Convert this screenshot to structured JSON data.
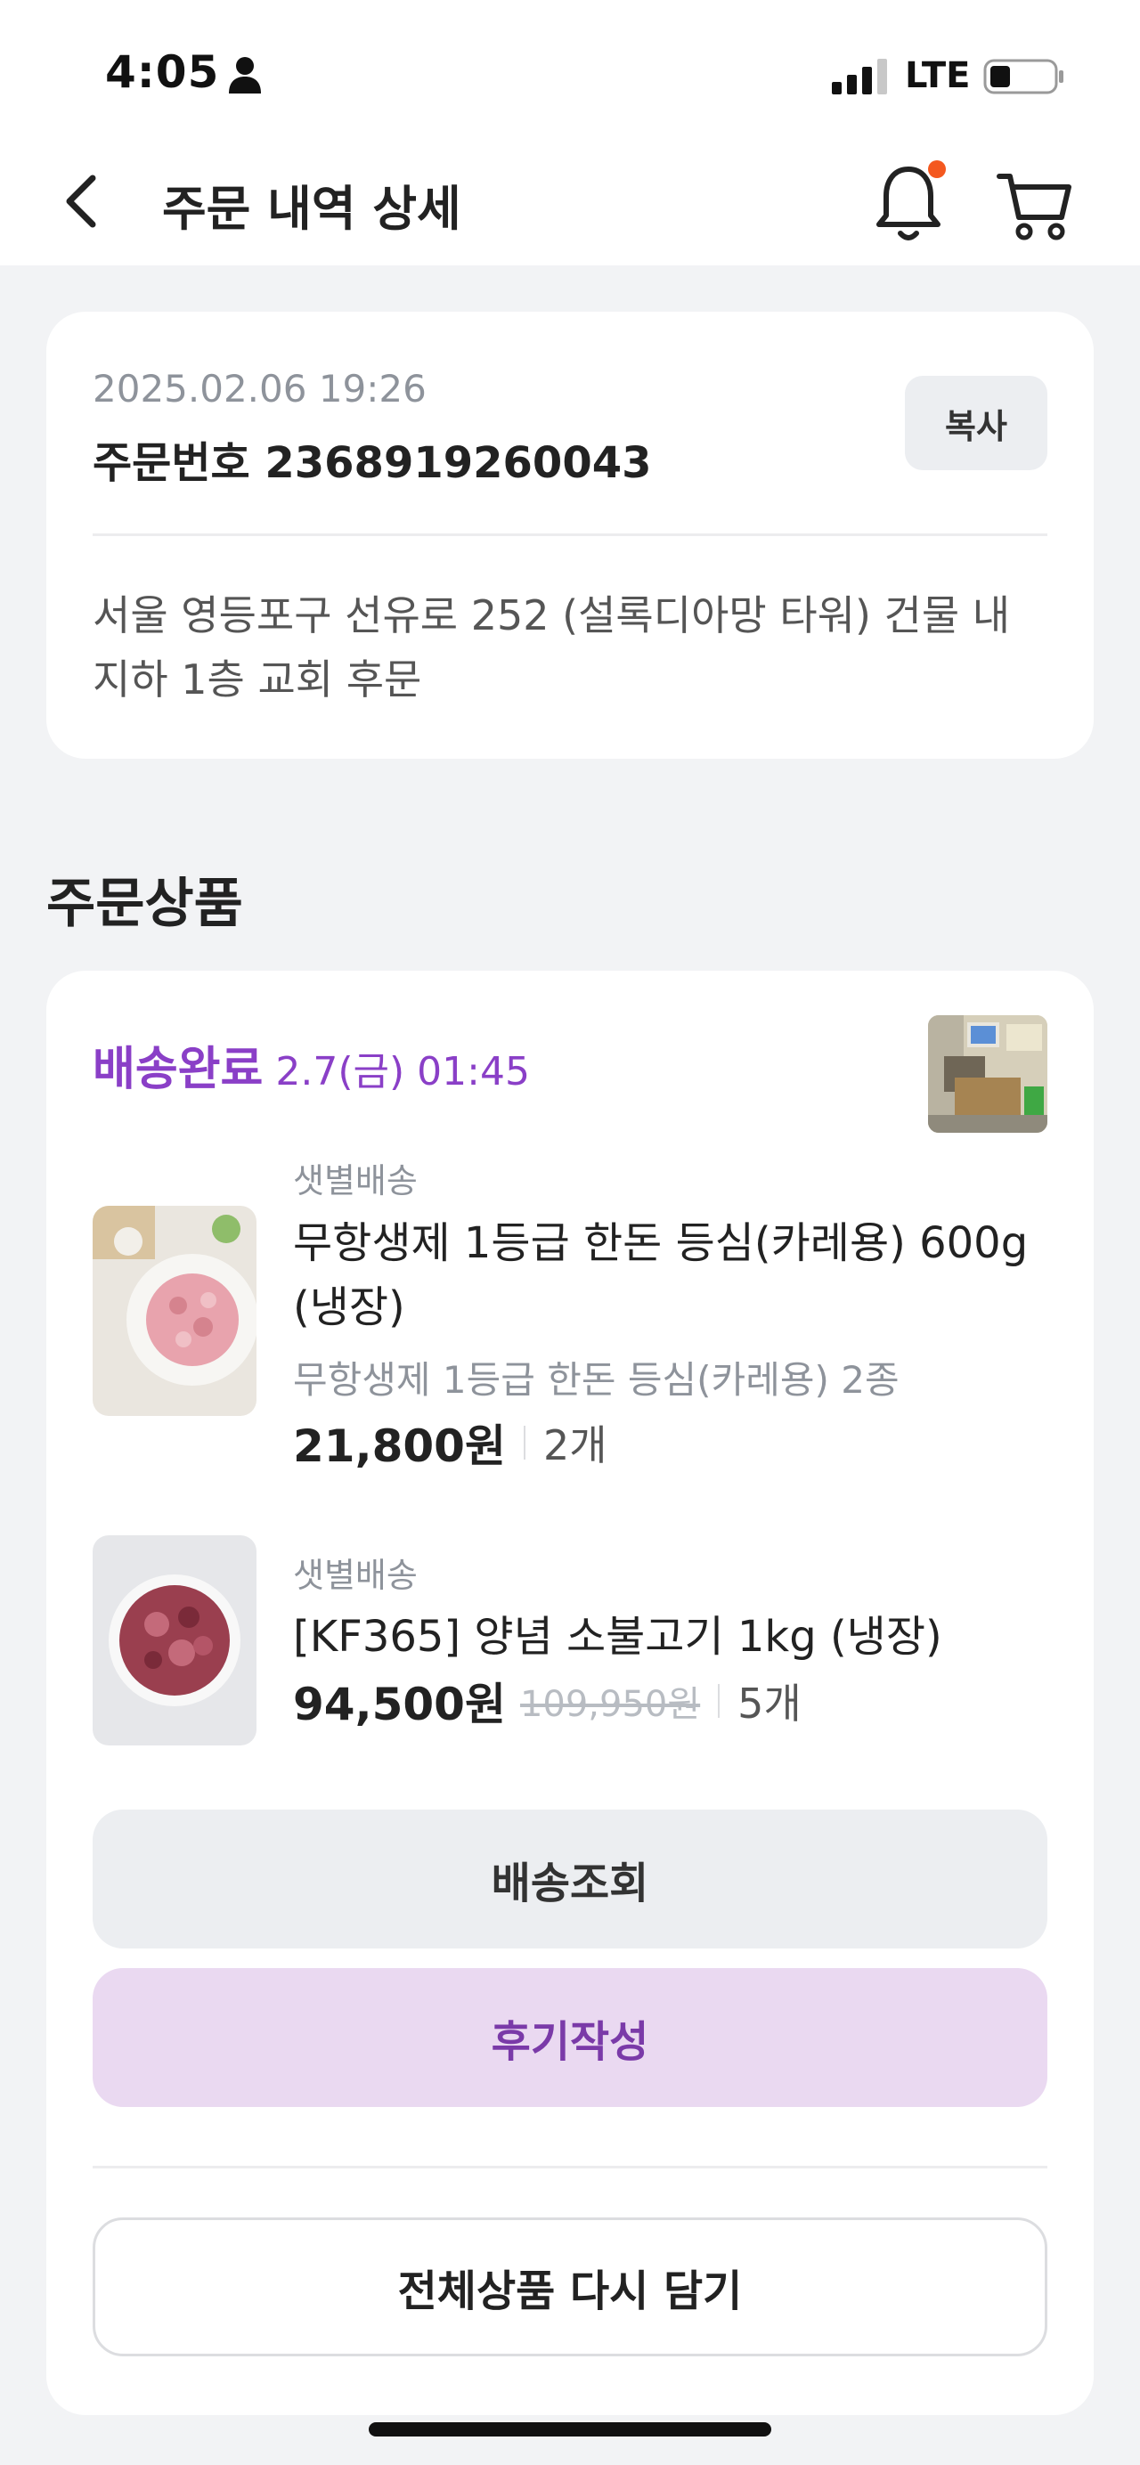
{
  "status_bar": {
    "time": "4:05",
    "network": "LTE"
  },
  "header": {
    "title": "주문 내역 상세"
  },
  "order": {
    "datetime": "2025.02.06 19:26",
    "number_label": "주문번호 2368919260043",
    "copy_label": "복사",
    "address": "서울 영등포구 선유로 252 (설록디아망 타워) 건물 내 지하 1층 교회 후문"
  },
  "section_title": "주문상품",
  "delivery": {
    "status": "배송완료",
    "time": "2.7(금) 01:45"
  },
  "items": [
    {
      "tag": "샛별배송",
      "name": "무항생제 1등급 한돈 등심(카레용) 600g (냉장)",
      "option": "무항생제 1등급 한돈 등심(카레용) 2종",
      "price": "21,800원",
      "original_price": "",
      "quantity": "2개"
    },
    {
      "tag": "샛별배송",
      "name": "[KF365] 양념 소불고기 1kg (냉장)",
      "option": "",
      "price": "94,500원",
      "original_price": "109,950원",
      "quantity": "5개"
    }
  ],
  "buttons": {
    "track": "배송조회",
    "review": "후기작성",
    "readd": "전체상품 다시 담기"
  },
  "colors": {
    "accent": "#8a3fc7",
    "review_bg": "#ead9f1",
    "badge_dot": "#f4581f"
  },
  "icons": [
    "person-icon",
    "signal-icon",
    "battery-icon",
    "back-arrow-icon",
    "bell-icon",
    "cart-icon"
  ]
}
